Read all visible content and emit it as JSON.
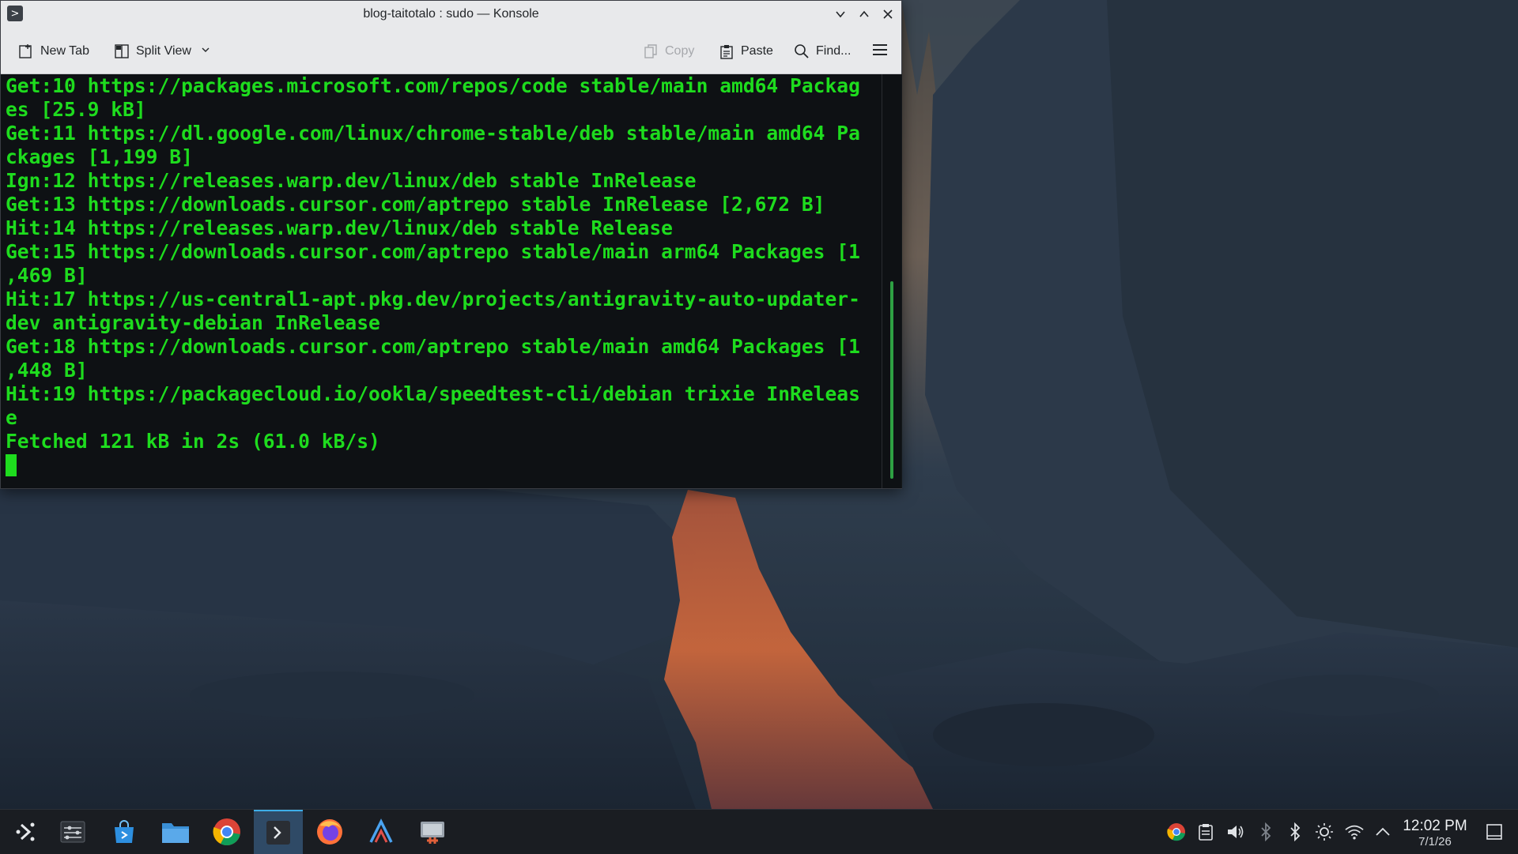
{
  "window": {
    "title": "blog-taitotalo : sudo — Konsole",
    "app_icon_glyph": ">",
    "controls": {
      "minimize": "⌄",
      "maximize": "⌃",
      "close": "✕"
    }
  },
  "toolbar": {
    "new_tab_label": "New Tab",
    "split_view_label": "Split View",
    "copy_label": "Copy",
    "paste_label": "Paste",
    "find_label": "Find..."
  },
  "terminal": {
    "text_color": "#1edc1e",
    "lines": [
      "Get:10 https://packages.microsoft.com/repos/code stable/main amd64 Packag",
      "es [25.9 kB]",
      "Get:11 https://dl.google.com/linux/chrome-stable/deb stable/main amd64 Pa",
      "ckages [1,199 B]",
      "Ign:12 https://releases.warp.dev/linux/deb stable InRelease",
      "Get:13 https://downloads.cursor.com/aptrepo stable InRelease [2,672 B]",
      "Hit:14 https://releases.warp.dev/linux/deb stable Release",
      "Get:15 https://downloads.cursor.com/aptrepo stable/main arm64 Packages [1",
      ",469 B]",
      "Hit:17 https://us-central1-apt.pkg.dev/projects/antigravity-auto-updater-",
      "dev antigravity-debian InRelease",
      "Get:18 https://downloads.cursor.com/aptrepo stable/main amd64 Packages [1",
      ",448 B]",
      "Hit:19 https://packagecloud.io/ookla/speedtest-cli/debian trixie InReleas",
      "e",
      "Fetched 121 kB in 2s (61.0 kB/s)"
    ]
  },
  "taskbar": {
    "apps": [
      {
        "name": "application-launcher-icon"
      },
      {
        "name": "system-settings-icon"
      },
      {
        "name": "discover-store-icon"
      },
      {
        "name": "file-manager-icon"
      },
      {
        "name": "chrome-icon"
      },
      {
        "name": "konsole-icon",
        "active": true
      },
      {
        "name": "firefox-icon"
      },
      {
        "name": "antigravity-icon"
      },
      {
        "name": "screenshot-tool-icon"
      }
    ],
    "tray": [
      "chrome-tray-icon",
      "clipboard-icon",
      "volume-icon",
      "bluetooth-disabled-icon",
      "bluetooth-icon",
      "brightness-icon",
      "wifi-icon",
      "tray-expand-icon"
    ],
    "clock": {
      "time": "12:02 PM",
      "date": "7/1/26"
    }
  },
  "colors": {
    "accent": "#3daee9",
    "taskbar_bg": "#1a1d22",
    "titlebar_bg": "#e8e9eb"
  }
}
